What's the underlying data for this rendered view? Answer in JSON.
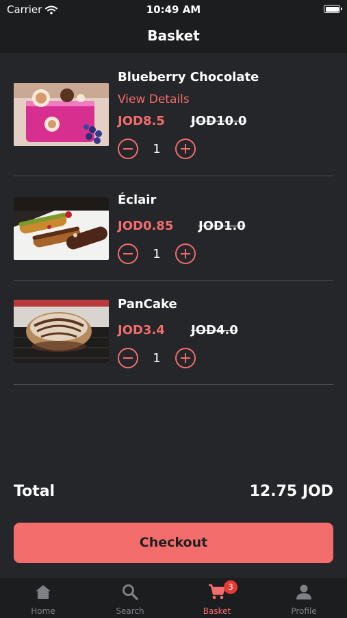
{
  "status_bar": {
    "carrier": "Carrier",
    "time": "10:49 AM"
  },
  "nav": {
    "title": "Basket"
  },
  "items": [
    {
      "title": "Blueberry Chocolate",
      "details_link": "View Details",
      "price": "JOD8.5",
      "old_price": "JOD10.0",
      "quantity": "1"
    },
    {
      "title": "Éclair",
      "price": "JOD0.85",
      "old_price": "JOD1.0",
      "quantity": "1"
    },
    {
      "title": "PanCake",
      "price": "JOD3.4",
      "old_price": "JOD4.0",
      "quantity": "1"
    }
  ],
  "summary": {
    "total_label": "Total",
    "total_value": "12.75 JOD"
  },
  "checkout_label": "Checkout",
  "tabs": [
    {
      "label": "Home",
      "icon": "home-icon"
    },
    {
      "label": "Search",
      "icon": "search-icon"
    },
    {
      "label": "Basket",
      "icon": "cart-icon",
      "badge": "3",
      "active": true
    },
    {
      "label": "Profile",
      "icon": "person-icon"
    }
  ],
  "colors": {
    "accent": "#f46d6d",
    "background": "#252629",
    "bar": "#1c1d1f",
    "inactive": "#7f8085",
    "badge": "#e53935"
  }
}
